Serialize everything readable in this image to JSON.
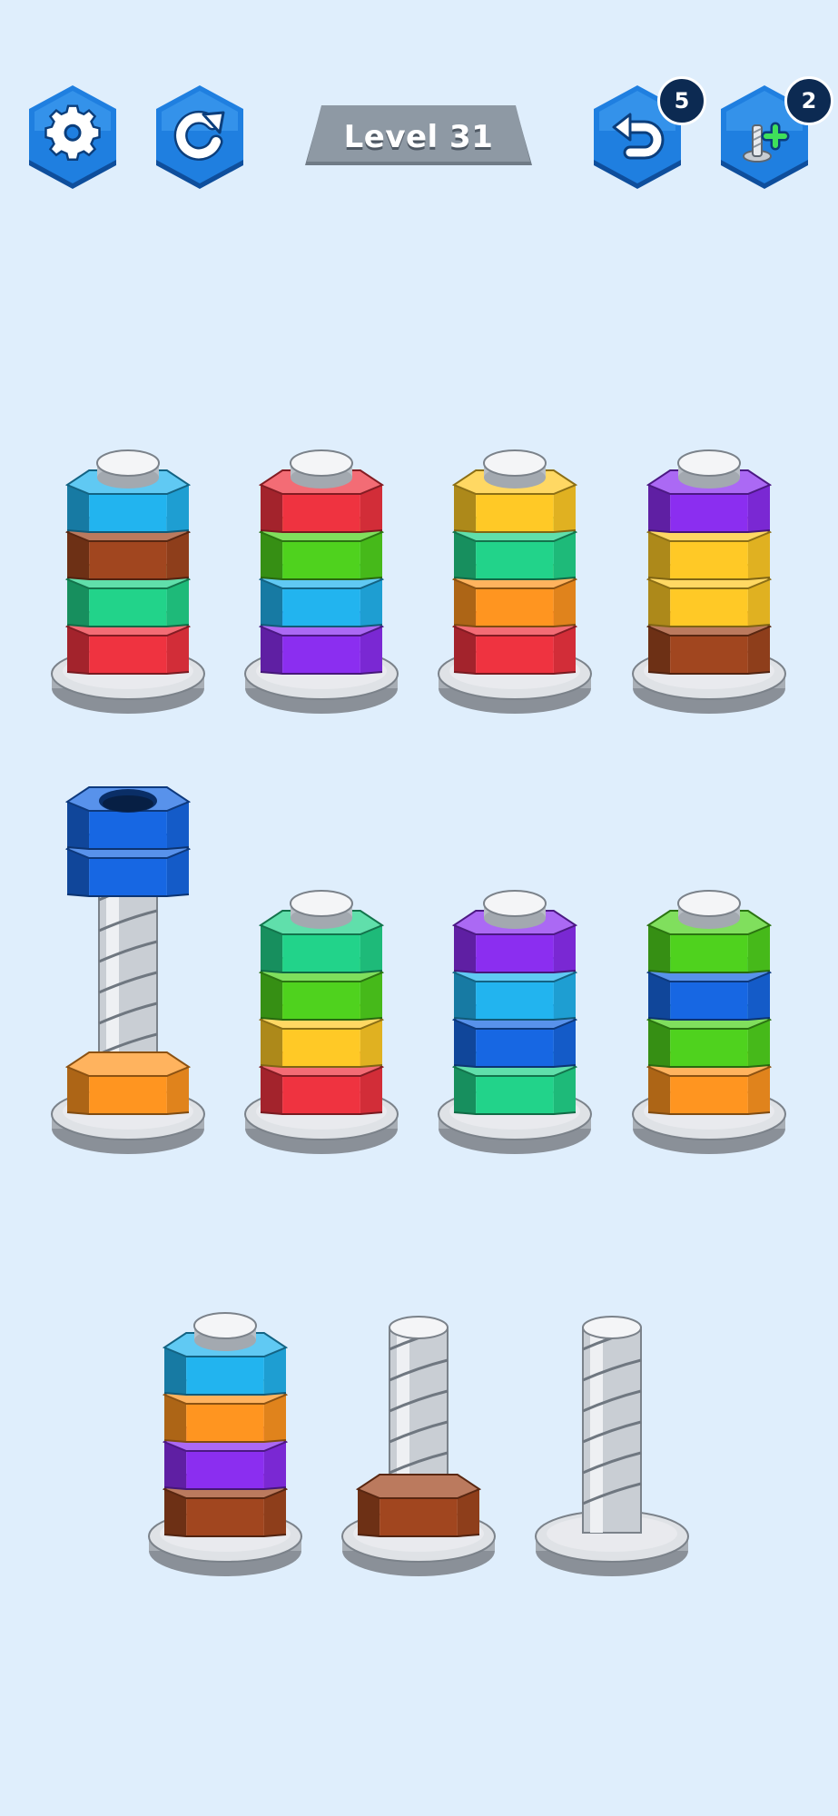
{
  "hud": {
    "settings_icon": "gear-icon",
    "restart_icon": "restart-icon",
    "level_label": "Level 31",
    "undo_icon": "undo-arrow-icon",
    "undo_count": "5",
    "add_screw_icon": "add-screw-icon",
    "add_screw_count": "2"
  },
  "colors": {
    "background": "#dfeefc",
    "button_blue": "#1f7fe0",
    "badge": "#0c2a52",
    "level_plate": "#8e99a4"
  },
  "nut_colors": {
    "cyan": "#22b4ef",
    "brown": "#a1461f",
    "green": "#22d38a",
    "red": "#ef3340",
    "lime": "#4fd21e",
    "purple": "#8b2ef0",
    "yellow": "#ffc926",
    "orange": "#ff9520",
    "blue": "#1767e3"
  },
  "bolts": [
    {
      "nuts_bottom_to_top": [
        "red",
        "green",
        "brown",
        "cyan"
      ],
      "lifted": []
    },
    {
      "nuts_bottom_to_top": [
        "purple",
        "cyan",
        "lime",
        "red"
      ],
      "lifted": []
    },
    {
      "nuts_bottom_to_top": [
        "red",
        "orange",
        "green",
        "yellow"
      ],
      "lifted": []
    },
    {
      "nuts_bottom_to_top": [
        "brown",
        "yellow",
        "yellow",
        "purple"
      ],
      "lifted": []
    },
    {
      "nuts_bottom_to_top": [
        "orange"
      ],
      "lifted": [
        "blue",
        "blue"
      ]
    },
    {
      "nuts_bottom_to_top": [
        "red",
        "yellow",
        "lime",
        "green"
      ],
      "lifted": []
    },
    {
      "nuts_bottom_to_top": [
        "green",
        "blue",
        "cyan",
        "purple"
      ],
      "lifted": []
    },
    {
      "nuts_bottom_to_top": [
        "orange",
        "lime",
        "blue",
        "lime"
      ],
      "lifted": []
    },
    {
      "nuts_bottom_to_top": [
        "brown",
        "purple",
        "orange",
        "cyan"
      ],
      "lifted": []
    },
    {
      "nuts_bottom_to_top": [
        "brown"
      ],
      "lifted": []
    },
    {
      "nuts_bottom_to_top": [],
      "lifted": []
    }
  ]
}
